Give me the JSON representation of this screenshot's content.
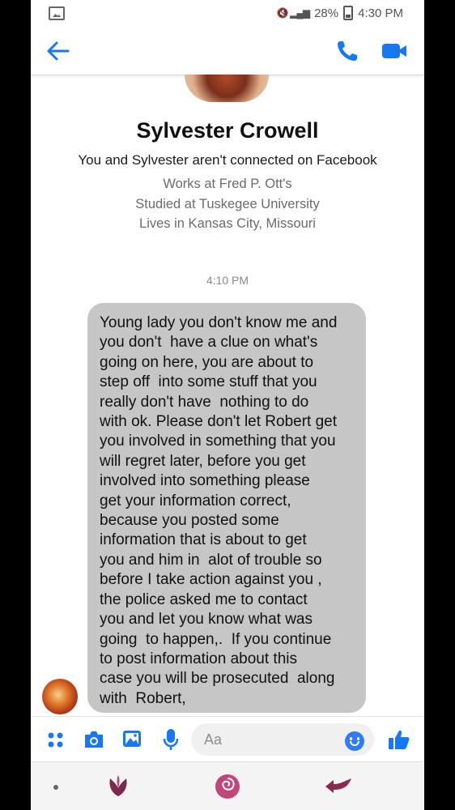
{
  "status_bar": {
    "battery": "28%",
    "time": "4:30 PM",
    "signal": "🔇 ▐"
  },
  "header": {
    "back_icon": "arrow-left-icon",
    "call_icon": "phone-icon",
    "video_icon": "video-camera-icon",
    "accent": "#1877f2"
  },
  "profile": {
    "name": "Sylvester Crowell",
    "connection": "You and Sylvester aren't connected on Facebook",
    "details": [
      "Works at Fred P. Ott's",
      "Studied at Tuskegee University",
      "Lives in Kansas City, Missouri"
    ]
  },
  "conversation": {
    "timestamp": "4:10 PM",
    "message_lines": [
      "Young lady you don't know me and",
      "you don't  have a clue on what's",
      "going on here, you are about to",
      "step off  into some stuff that you",
      "really don't have  nothing to do",
      "with ok. Please don't let Robert get",
      "you involved in something that you",
      "will regret later, before you get",
      "involved into something please",
      "get your information correct,",
      "because you posted some",
      "information that is about to get",
      "you and him in  alot of trouble so",
      "before I take action against you ,",
      "the police asked me to contact",
      "you and let you know what was",
      "going  to happen,.  If you continue",
      "to post information about this",
      "case you will be prosecuted  along",
      "with  Robert,"
    ],
    "bubble_color": "#c6c6c6"
  },
  "composer": {
    "placeholder": "Aa",
    "icons": [
      "apps-grid-icon",
      "camera-icon",
      "image-icon",
      "microphone-icon",
      "emoji-icon",
      "thumbs-up-icon"
    ]
  },
  "nav": {
    "icons": [
      "menu-dot-icon",
      "recent-apps-icon",
      "home-rose-icon",
      "back-arrow-icon"
    ]
  }
}
